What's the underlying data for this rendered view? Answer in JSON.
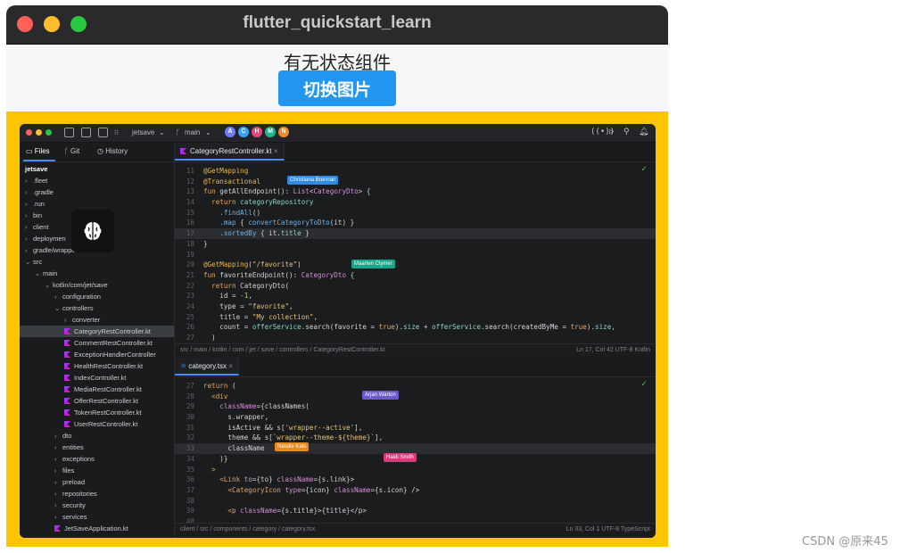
{
  "window": {
    "title": "flutter_quickstart_learn"
  },
  "page": {
    "heading": "有无状态组件",
    "button_label": "切换图片"
  },
  "ide": {
    "project": "jetsave",
    "branch": "main",
    "avatars": [
      {
        "letter": "A",
        "color": "#6b7bff"
      },
      {
        "letter": "C",
        "color": "#3aa0ff"
      },
      {
        "letter": "H",
        "color": "#e2487e"
      },
      {
        "letter": "M",
        "color": "#1fb58f"
      },
      {
        "letter": "N",
        "color": "#f08b2c"
      }
    ],
    "sidebar_tabs": [
      "Files",
      "Git",
      "History"
    ],
    "tree": [
      {
        "label": "jetsave",
        "depth": 0,
        "chev": "",
        "root": true
      },
      {
        "label": ".fleet",
        "depth": 0,
        "chev": "›"
      },
      {
        "label": ".gradle",
        "depth": 0,
        "chev": "›"
      },
      {
        "label": ".run",
        "depth": 0,
        "chev": "›"
      },
      {
        "label": "bin",
        "depth": 0,
        "chev": "›"
      },
      {
        "label": "client",
        "depth": 0,
        "chev": "›"
      },
      {
        "label": "deploymen",
        "depth": 0,
        "chev": "›"
      },
      {
        "label": "gradle/wrapper",
        "depth": 0,
        "chev": "›"
      },
      {
        "label": "src",
        "depth": 0,
        "chev": "⌄"
      },
      {
        "label": "main",
        "depth": 1,
        "chev": "⌄"
      },
      {
        "label": "kotlin/com/jet/save",
        "depth": 2,
        "chev": "⌄"
      },
      {
        "label": "configuration",
        "depth": 3,
        "chev": "›"
      },
      {
        "label": "controllers",
        "depth": 3,
        "chev": "⌄"
      },
      {
        "label": "converter",
        "depth": 4,
        "chev": "›"
      },
      {
        "label": "CategoryRestController.kt",
        "depth": 4,
        "chev": "",
        "kt": true,
        "sel": true
      },
      {
        "label": "CommentRestController.kt",
        "depth": 4,
        "chev": "",
        "kt": true
      },
      {
        "label": "ExceptionHandlerController",
        "depth": 4,
        "chev": "",
        "kt": true
      },
      {
        "label": "HealthRestController.kt",
        "depth": 4,
        "chev": "",
        "kt": true
      },
      {
        "label": "IndexController.kt",
        "depth": 4,
        "chev": "",
        "kt": true
      },
      {
        "label": "MediaRestController.kt",
        "depth": 4,
        "chev": "",
        "kt": true
      },
      {
        "label": "OfferRestController.kt",
        "depth": 4,
        "chev": "",
        "kt": true
      },
      {
        "label": "TokenRestController.kt",
        "depth": 4,
        "chev": "",
        "kt": true
      },
      {
        "label": "UserRestController.kt",
        "depth": 4,
        "chev": "",
        "kt": true
      },
      {
        "label": "dto",
        "depth": 3,
        "chev": "›"
      },
      {
        "label": "entities",
        "depth": 3,
        "chev": "›"
      },
      {
        "label": "exceptions",
        "depth": 3,
        "chev": "›"
      },
      {
        "label": "files",
        "depth": 3,
        "chev": "›"
      },
      {
        "label": "preload",
        "depth": 3,
        "chev": "›"
      },
      {
        "label": "repositories",
        "depth": 3,
        "chev": "›"
      },
      {
        "label": "security",
        "depth": 3,
        "chev": "›"
      },
      {
        "label": "services",
        "depth": 3,
        "chev": "›"
      },
      {
        "label": "JetSaveApplication.kt",
        "depth": 3,
        "chev": "",
        "kt": true
      }
    ],
    "editor1": {
      "tab": "CategoryRestController.kt",
      "status_path": "src / main / kotlin / com / jet / save / controllers / CategoryRestController.kt",
      "status_right": "Ln 17, Col 42    UTF-8    Kotlin",
      "collaborators": [
        {
          "name": "Christiana Brennan",
          "color": "#2f8be6"
        },
        {
          "name": "Maarten Clymer",
          "color": "#1aa58a"
        }
      ]
    },
    "editor2": {
      "tab": "category.tsx",
      "status_path": "client / src / components / category / category.tsx",
      "status_right": "Ln 33, Col 1    UTF-8    TypeScript",
      "collaborators": [
        {
          "name": "Arjan Warton",
          "color": "#6a5acd"
        },
        {
          "name": "Natalie Kats",
          "color": "#e58a1f"
        },
        {
          "name": "Haidi Smith",
          "color": "#d63a7a"
        }
      ]
    }
  },
  "watermark": "CSDN @原来45"
}
